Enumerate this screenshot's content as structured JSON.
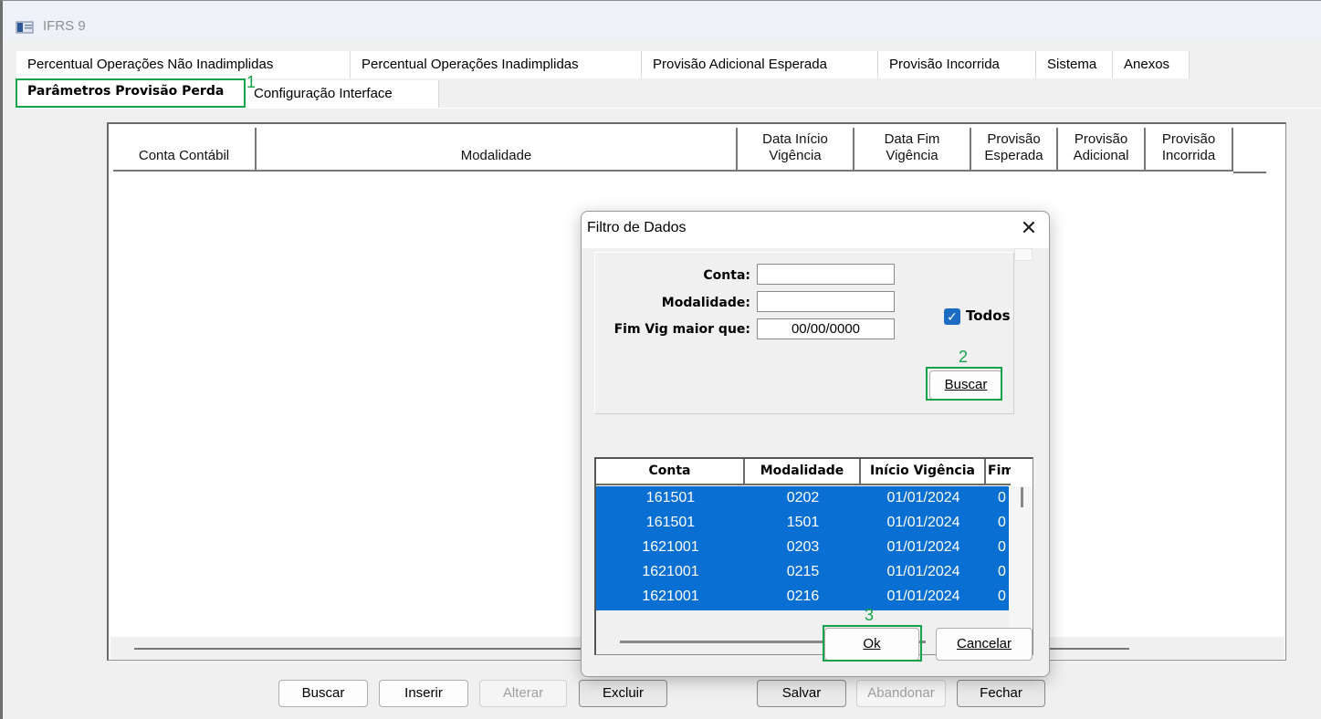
{
  "window": {
    "title": "IFRS 9"
  },
  "tabs": {
    "row1": [
      "Percentual Operações Não Inadimplidas",
      "Percentual Operações Inadimplidas",
      "Provisão Adicional Esperada",
      "Provisão Incorrida",
      "Sistema",
      "Anexos"
    ],
    "row2": [
      "Parâmetros Provisão Perda",
      "Configuração Interface"
    ],
    "active": "Parâmetros Provisão Perda"
  },
  "main_grid": {
    "columns": [
      "Conta Contábil",
      "Modalidade",
      "Data Início\nVigência",
      "Data Fim\nVigência",
      "Provisão\nEsperada",
      "Provisão\nAdicional",
      "Provisão\nIncorrida"
    ],
    "rows": []
  },
  "buttons": {
    "buscar": "Buscar",
    "inserir": "Inserir",
    "alterar": "Alterar",
    "excluir": "Excluir",
    "salvar": "Salvar",
    "abandonar": "Abandonar",
    "fechar": "Fechar"
  },
  "dialog": {
    "title": "Filtro de Dados",
    "close_glyph": "✕",
    "labels": {
      "conta": "Conta:",
      "modalidade": "Modalidade:",
      "fim_vig": "Fim Vig maior que:"
    },
    "values": {
      "conta": "",
      "modalidade": "",
      "fim_vig": "00/00/0000"
    },
    "todos": {
      "label": "Todos",
      "checked": true
    },
    "buscar_button": "Buscar",
    "results": {
      "columns": [
        "Conta",
        "Modalidade",
        "Início Vigência",
        "Fim"
      ],
      "rows": [
        [
          "161501",
          "0202",
          "01/01/2024",
          "0"
        ],
        [
          "161501",
          "1501",
          "01/01/2024",
          "0"
        ],
        [
          "1621001",
          "0203",
          "01/01/2024",
          "0"
        ],
        [
          "1621001",
          "0215",
          "01/01/2024",
          "0"
        ],
        [
          "1621001",
          "0216",
          "01/01/2024",
          "0"
        ]
      ]
    },
    "ok_button": "Ok",
    "cancel_button": "Cancelar"
  },
  "annotations": {
    "step1": "1",
    "step2": "2",
    "step3": "3"
  },
  "colors": {
    "selection": "#0a6fd3",
    "highlight": "#14a34a",
    "checkbox": "#1c6cc4"
  }
}
